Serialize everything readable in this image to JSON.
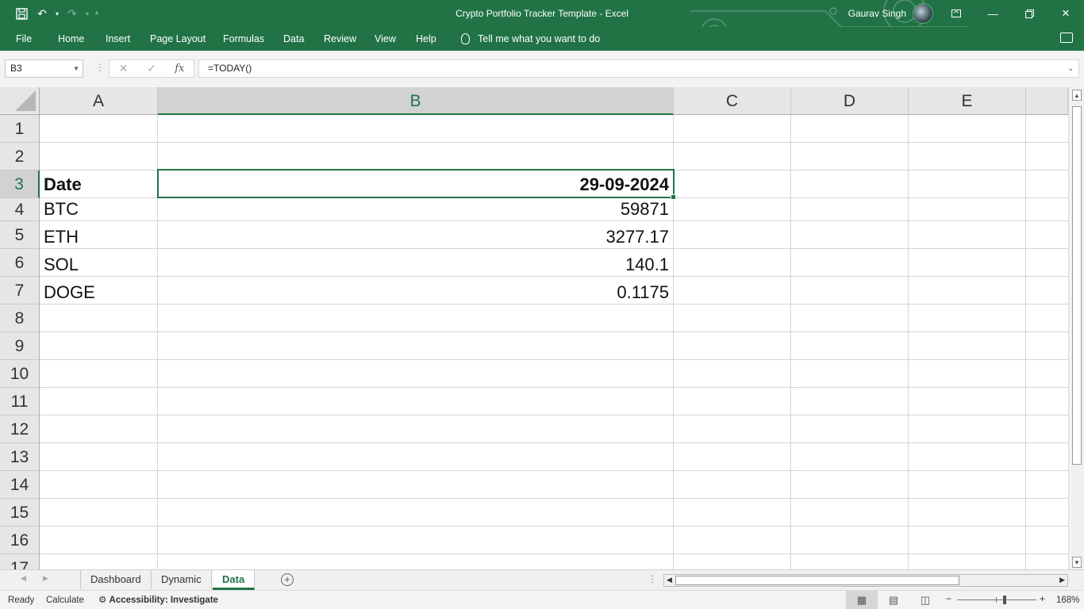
{
  "titlebar": {
    "title": "Crypto Portfolio Tracker Template  -  Excel",
    "user_name": "Gaurav Singh"
  },
  "ribbon": {
    "tabs": [
      "File",
      "Home",
      "Insert",
      "Page Layout",
      "Formulas",
      "Data",
      "Review",
      "View",
      "Help"
    ],
    "tell_me": "Tell me what you want to do"
  },
  "formula_bar": {
    "name_box": "B3",
    "fx": "fx",
    "formula": "=TODAY()"
  },
  "grid": {
    "columns": [
      "A",
      "B",
      "C",
      "D",
      "E"
    ],
    "selected_column": "B",
    "row_numbers": [
      "1",
      "2",
      "3",
      "4",
      "5",
      "6",
      "7",
      "8",
      "9",
      "10",
      "11",
      "12",
      "13",
      "14",
      "15",
      "16",
      "17"
    ],
    "selected_row": "3",
    "rows": [
      {
        "a": "Date",
        "b": "29-09-2024",
        "bold": true
      },
      {
        "a": "BTC",
        "b": "59871"
      },
      {
        "a": "ETH",
        "b": "3277.17"
      },
      {
        "a": "SOL",
        "b": "140.1"
      },
      {
        "a": "DOGE",
        "b": "0.1175"
      }
    ]
  },
  "sheet_tabs": {
    "tabs": [
      "Dashboard",
      "Dynamic",
      "Data"
    ],
    "active": "Data"
  },
  "status_bar": {
    "ready": "Ready",
    "calculate": "Calculate",
    "accessibility": "Accessibility: Investigate",
    "zoom": "168%"
  },
  "colors": {
    "accent": "#217346",
    "gridline": "#d4d4d4"
  }
}
